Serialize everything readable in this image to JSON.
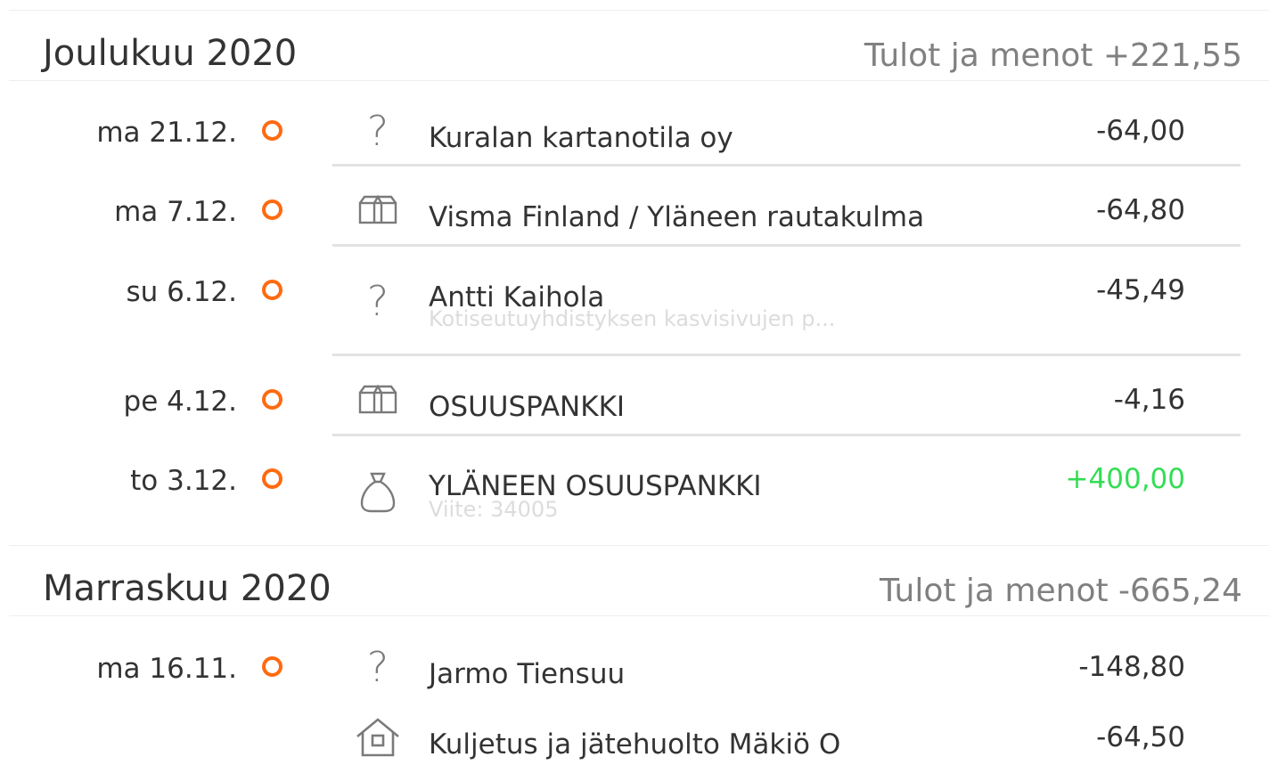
{
  "months": [
    {
      "title": "Joulukuu 2020",
      "total": "Tulot ja menot +221,55",
      "transactions": [
        {
          "date": "ma 21.12.",
          "icon": "question-icon",
          "name": "Kuralan kartanotila oy",
          "sub": "",
          "amount": "-64,00"
        },
        {
          "date": "ma 7.12.",
          "icon": "box-icon",
          "name": "Visma Finland / Yläneen rautakulma",
          "sub": "",
          "amount": "-64,80"
        },
        {
          "date": "su 6.12.",
          "icon": "question-icon",
          "name": "Antti Kaihola",
          "sub": "Kotiseutuyhdistyksen kasvisivujen p...",
          "amount": "-45,49"
        },
        {
          "date": "pe 4.12.",
          "icon": "box-icon",
          "name": "OSUUSPANKKI",
          "sub": "",
          "amount": "-4,16"
        },
        {
          "date": "to 3.12.",
          "icon": "money-bag-icon",
          "name": "YLÄNEEN OSUUSPANKKI",
          "sub": "Viite: 34005",
          "amount": "+400,00"
        }
      ]
    },
    {
      "title": "Marraskuu 2020",
      "total": "Tulot ja menot -665,24",
      "transactions": [
        {
          "date": "ma 16.11.",
          "icon": "question-icon",
          "name": "Jarmo Tiensuu",
          "sub": "",
          "amount": "-148,80"
        },
        {
          "date": "",
          "icon": "house-icon",
          "name": "Kuljetus ja jätehuolto Mäkiö O",
          "sub": "",
          "amount": "-64,50"
        }
      ]
    }
  ],
  "colors": {
    "status_dot": "#ff6a10",
    "positive_amount": "#33dd55",
    "muted_text": "#808080"
  }
}
